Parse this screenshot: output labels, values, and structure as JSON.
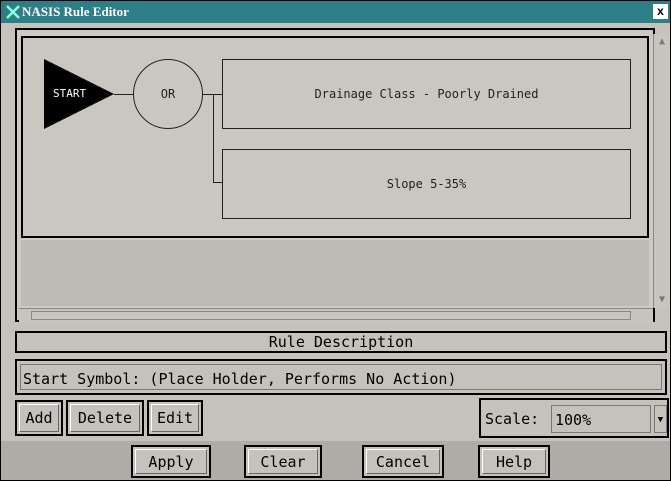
{
  "window": {
    "title": "NASIS Rule Editor",
    "close_label": "x"
  },
  "diagram": {
    "start_label": "START",
    "operator_label": "OR",
    "rules": [
      {
        "label": "Drainage Class - Poorly Drained"
      },
      {
        "label": "Slope 5-35%"
      }
    ]
  },
  "rule_description": {
    "header": "Rule Description",
    "text": "Start Symbol: (Place Holder, Performs No Action)"
  },
  "toolbar": {
    "add_label": "Add",
    "delete_label": "Delete",
    "edit_label": "Edit",
    "scale_label": "Scale:",
    "scale_value": "100%"
  },
  "actions": {
    "apply_label": "Apply",
    "clear_label": "Clear",
    "cancel_label": "Cancel",
    "help_label": "Help"
  },
  "colors": {
    "titlebar": "#2e7e88",
    "background": "#c5c2bc"
  }
}
